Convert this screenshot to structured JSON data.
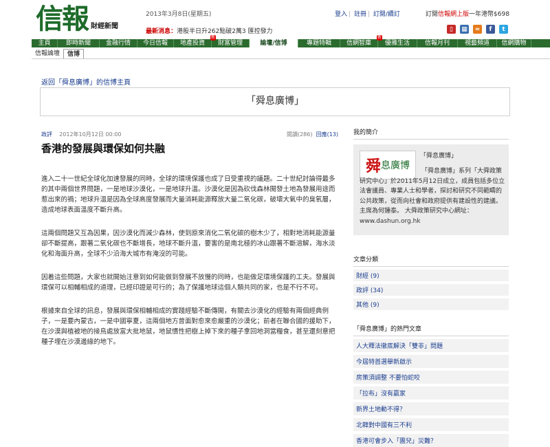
{
  "header": {
    "logo_big": "信報",
    "logo_small": "財經新聞",
    "date": "2013年3月8日(星期五)",
    "ticker_label": "最新消息：",
    "ticker_text": "港股半日升262點破2萬3 匯控發力",
    "top_links": [
      "登入",
      "註冊",
      "訂閱/續訂"
    ],
    "promo_prefix": "訂閱",
    "promo_red": "信報網上版",
    "promo_suffix": "一年港幣$698",
    "icons": [
      "mobile-icon",
      "app-icon",
      "rss-icon",
      "facebook-icon",
      "twitter-icon"
    ],
    "icon_glyphs": [
      "▯",
      "▦",
      "≈",
      "f",
      "t"
    ]
  },
  "nav": {
    "items": [
      {
        "label": "主頁",
        "new": false
      },
      {
        "label": "即時新聞",
        "new": false
      },
      {
        "label": "金融行情",
        "new": false
      },
      {
        "label": "今日信報",
        "new": false
      },
      {
        "label": "地產投資",
        "new": false
      },
      {
        "label": "財富管理",
        "new": true
      },
      {
        "label": "論壇/信博",
        "new": false,
        "active": true
      },
      {
        "label": "專題特輯",
        "new": false
      },
      {
        "label": "信網智庫",
        "new": false
      },
      {
        "label": "優雅生活",
        "new": true
      },
      {
        "label": "信報月刊",
        "new": false
      },
      {
        "label": "視藝頻道",
        "new": false
      },
      {
        "label": "信網購物",
        "new": false
      }
    ],
    "new_badge": "新"
  },
  "subnav": [
    "信報論壇",
    "信博"
  ],
  "back_link": "返回「舜息廣博」的信博主頁",
  "blog_title": "「舜息廣博」",
  "post": {
    "category": "政評",
    "datetime": "2012年10月12日 00:00",
    "views": "閱讀(286)",
    "replies": "回應(13)",
    "title": "香港的發展與環保如何共融",
    "paragraphs": [
      "進入二十一世紀全球化加速發展的同時，全球的環境保護也成了日受重視的議題。二十世紀討論得最多的其中兩個世界問題，一是地球沙漠化，一是地球升溫。沙漠化是因為砍伐森林開發土地為發展用途而惹出來的禍；地球升溫是因為全球高度發展而大量消耗能源釋放大量二氧化碳，破壞大氣中的臭氧層，造成地球表面溫度不斷升高。",
      "這兩個問題又互為因果，因沙漠化而減少森林，使到原來消化二氧化碳的樹木少了，相對地消耗能源量卻不斷提高，跟著二氧化碳也不斷增長，地球不斷升溫，要害的是南北極的冰山跟著不斷溶解，海水淡化和海面升高，全球不少沿海大城市有淹沒的可能。",
      "因着這些問題，大家也就開始注意到如何能做到發展不放慢的同時，也能做足環境保護的工夫。發展與環保可以相輔相成的道理，已經印證是可行的；為了保護地球這個人類共同的家，也是不行不可。",
      "根據來自全球的訊息，發展與環保相輔相成的實踐經驗不斷傳開，有關去沙漠化的經驗有兩個經典例子，一是要內蒙古，一是中國寧夏，這兩個地方曾面對愈來愈嚴重的沙漠化；前者在聯合國的援助下，在沙漠與植被地的接鳥處放富大批地鼠，地鼠慣性把樹上掉下來的種子拿回地洞當糧食，甚至還刻意把種子埋在沙漠邊緣的地下。"
    ]
  },
  "sidebar": {
    "profile_heading": "我的簡介",
    "profile_logo_a": "舜",
    "profile_logo_b": "息廣博",
    "profile_name": "「舜息廣博」",
    "profile_desc": "「舜息廣博」系列「大舜政策研究中心」於2011年5月12日成立，成員包括多位立法會議員、專業人士和學者，探討和研究不同範疇的公共政策，從而向社會和政府提供有建設性的建議。主席為何鍾泰。 大舜政策研究中心網址：www.dashun.org.hk",
    "categories_heading": "文章分類",
    "categories": [
      "財經 (9)",
      "政評 (34)",
      "其他 (9)"
    ],
    "hot_heading": "「舜息廣博」的熱門文章",
    "hot": [
      "人大釋法徹底解決「雙非」問題",
      "今屆特首選舉新啟示",
      "房策須調整 不要怕蛇咬",
      "「拉布」沒有贏家",
      "新界土地動不得？",
      "北韓對中國有三不利",
      "香港可會步入「團兒」災難？"
    ]
  },
  "colors": {
    "brand_green": "#2b6b2e",
    "link_blue": "#1a3d8f",
    "alert_red": "#cc0000",
    "icon_colors": [
      "#c62828",
      "#3b6fb0",
      "#e57a1a",
      "#3b5998",
      "#2ca5e0"
    ]
  }
}
